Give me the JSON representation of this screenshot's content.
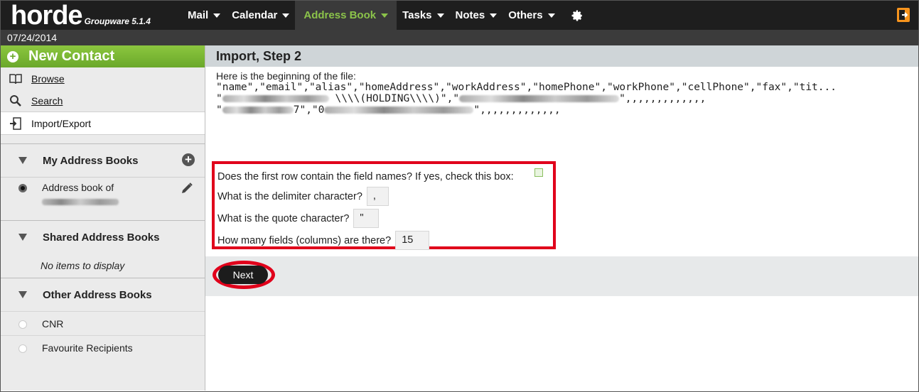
{
  "header": {
    "brand": "horde",
    "version": "Groupware 5.1.4",
    "menu": [
      {
        "label": "Mail"
      },
      {
        "label": "Calendar"
      },
      {
        "label": "Address Book"
      },
      {
        "label": "Tasks"
      },
      {
        "label": "Notes"
      },
      {
        "label": "Others"
      }
    ],
    "date": "07/24/2014"
  },
  "sidebar": {
    "new_contact": "New Contact",
    "nav": [
      {
        "label": "Browse",
        "icon": "book-icon"
      },
      {
        "label": "Search",
        "icon": "search-icon"
      },
      {
        "label": "Import/Export",
        "icon": "import-export-icon"
      }
    ],
    "my_books_title": "My Address Books",
    "my_book_label": "Address book of",
    "shared_title": "Shared Address Books",
    "shared_empty": "No items to display",
    "other_title": "Other Address Books",
    "other_books": [
      "CNR",
      "Favourite Recipients"
    ]
  },
  "main": {
    "title": "Import, Step 2",
    "file_intro": "Here is the beginning of the file:",
    "file_line1": "\"name\",\"email\",\"alias\",\"homeAddress\",\"workAddress\",\"homePhone\",\"workPhone\",\"cellPhone\",\"fax\",\"tit...",
    "file_line2_text": "\\\\\\\\(HOLDING\\\\\\\\)\",\"",
    "file_line2_tail": "\",,,,,,,,,,,,,",
    "file_line3_mid": "7\",\"0",
    "file_line3_tail": "\",,,,,,,,,,,,,",
    "q_first_row": "Does the first row contain the field names? If yes, check this box:",
    "q_delimiter": "What is the delimiter character?",
    "delimiter_value": ",",
    "q_quote": "What is the quote character?",
    "quote_value": "\"",
    "q_fields": "How many fields (columns) are there?",
    "fields_value": "15",
    "next_label": "Next"
  },
  "colors": {
    "accent_green": "#8cc63f",
    "highlight_red": "#e0001b",
    "topbar": "#1e1e1e"
  }
}
